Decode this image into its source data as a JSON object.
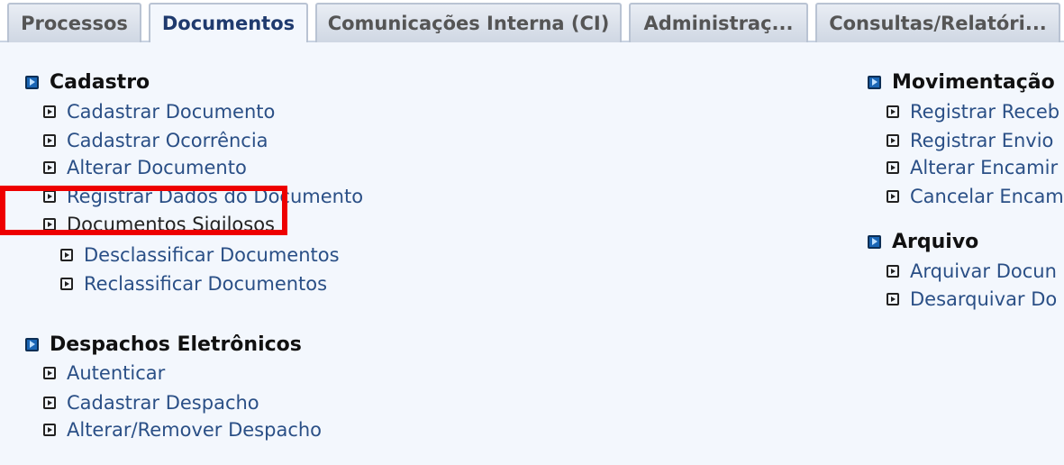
{
  "tabs": [
    {
      "label": "Processos"
    },
    {
      "label": "Documentos"
    },
    {
      "label": "Comunicações Interna (CI)"
    },
    {
      "label": "Administraç..."
    },
    {
      "label": "Consultas/Relatóri..."
    }
  ],
  "cadastro": {
    "title": "Cadastro",
    "items": [
      "Cadastrar Documento",
      "Cadastrar Ocorrência",
      "Alterar Documento",
      "Registrar Dados do Documento",
      "Documentos Sigilosos",
      "Desclassificar Documentos",
      "Reclassificar Documentos"
    ]
  },
  "despachos": {
    "title": "Despachos Eletrônicos",
    "items": [
      "Autenticar",
      "Cadastrar Despacho",
      "Alterar/Remover Despacho"
    ]
  },
  "movimentacao": {
    "title": "Movimentação",
    "items": [
      "Registrar Receb",
      "Registrar Envio",
      "Alterar Encamir",
      "Cancelar Encam"
    ]
  },
  "arquivo": {
    "title": "Arquivo",
    "items": [
      "Arquivar Docun",
      "Desarquivar Do"
    ]
  },
  "colors": {
    "link": "#2a4f86",
    "highlight": "#ee0000",
    "content_bg": "#f3f7fd"
  }
}
